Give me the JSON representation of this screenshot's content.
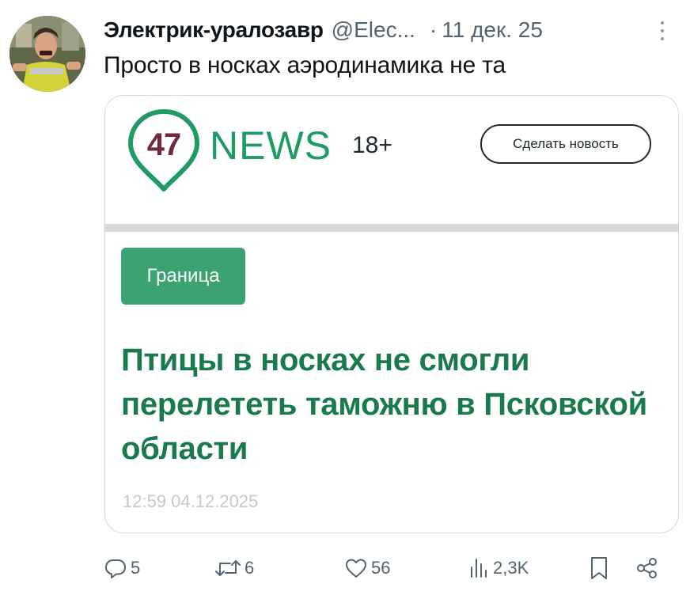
{
  "post": {
    "author_name": "Электрик-уралозавр",
    "author_handle": "@Elec...",
    "separator": "·",
    "date": "11 дек. 25",
    "text": "Просто в носках аэродинамика не та"
  },
  "card": {
    "logo_number": "47",
    "logo_news": "NEWS",
    "logo_age": "18+",
    "make_news_label": "Сделать новость",
    "category": "Граница",
    "title": "Птицы в носках не смогли перелететь таможню в Псковской области",
    "timestamp": "12:59 04.12.2025"
  },
  "actions": {
    "replies": "5",
    "reposts": "6",
    "likes": "56",
    "views": "2,3K"
  },
  "icons": {
    "more": "more-vertical-icon",
    "reply": "reply-icon",
    "repost": "repost-icon",
    "like": "heart-icon",
    "views": "bar-chart-icon",
    "bookmark": "bookmark-icon",
    "share": "share-icon"
  },
  "colors": {
    "text_primary": "#0f1419",
    "text_secondary": "#536471",
    "brand_green": "#1f9b63",
    "title_green": "#1a7a4e",
    "badge_green": "#3aa36f",
    "logo_maroon": "#6e2a3e"
  }
}
